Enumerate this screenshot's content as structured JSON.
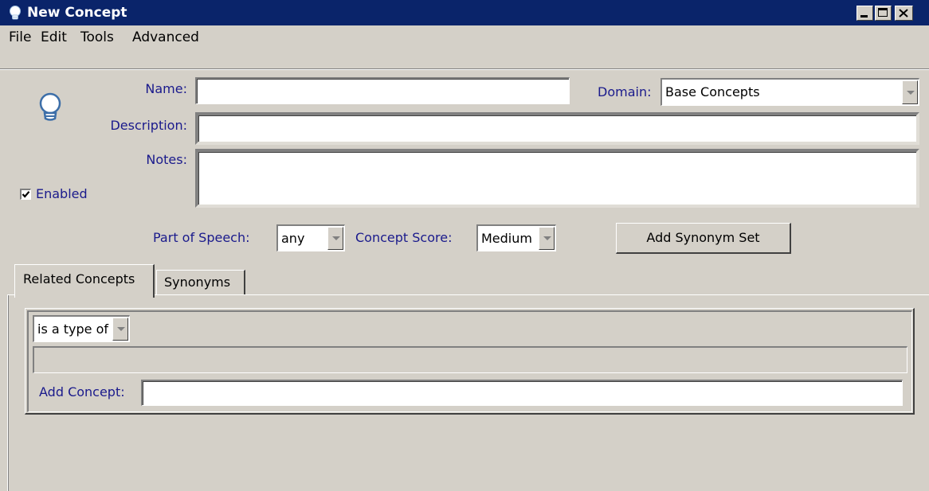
{
  "window": {
    "title": "New Concept",
    "titlebar_color": "#0a246a",
    "icon": "lightbulb-icon"
  },
  "menu": {
    "items": [
      "File",
      "Edit",
      "Tools",
      "Advanced"
    ]
  },
  "form": {
    "name_label": "Name:",
    "name_value": "",
    "domain_label": "Domain:",
    "domain_value": "Base Concepts",
    "description_label": "Description:",
    "description_value": "",
    "notes_label": "Notes:",
    "notes_value": "",
    "enabled_label": "Enabled",
    "enabled_checked": true,
    "pos_label": "Part of Speech:",
    "pos_value": "any",
    "score_label": "Concept Score:",
    "score_value": "Medium",
    "add_synonym_set_label": "Add Synonym Set"
  },
  "tabs": {
    "items": [
      "Related Concepts",
      "Synonyms"
    ],
    "active": "Related Concepts"
  },
  "related": {
    "relation_value": "is a type of",
    "add_concept_label": "Add Concept:",
    "add_concept_value": ""
  },
  "colors": {
    "label_color": "#1a1a8c",
    "window_bg": "#d4d0c8"
  }
}
